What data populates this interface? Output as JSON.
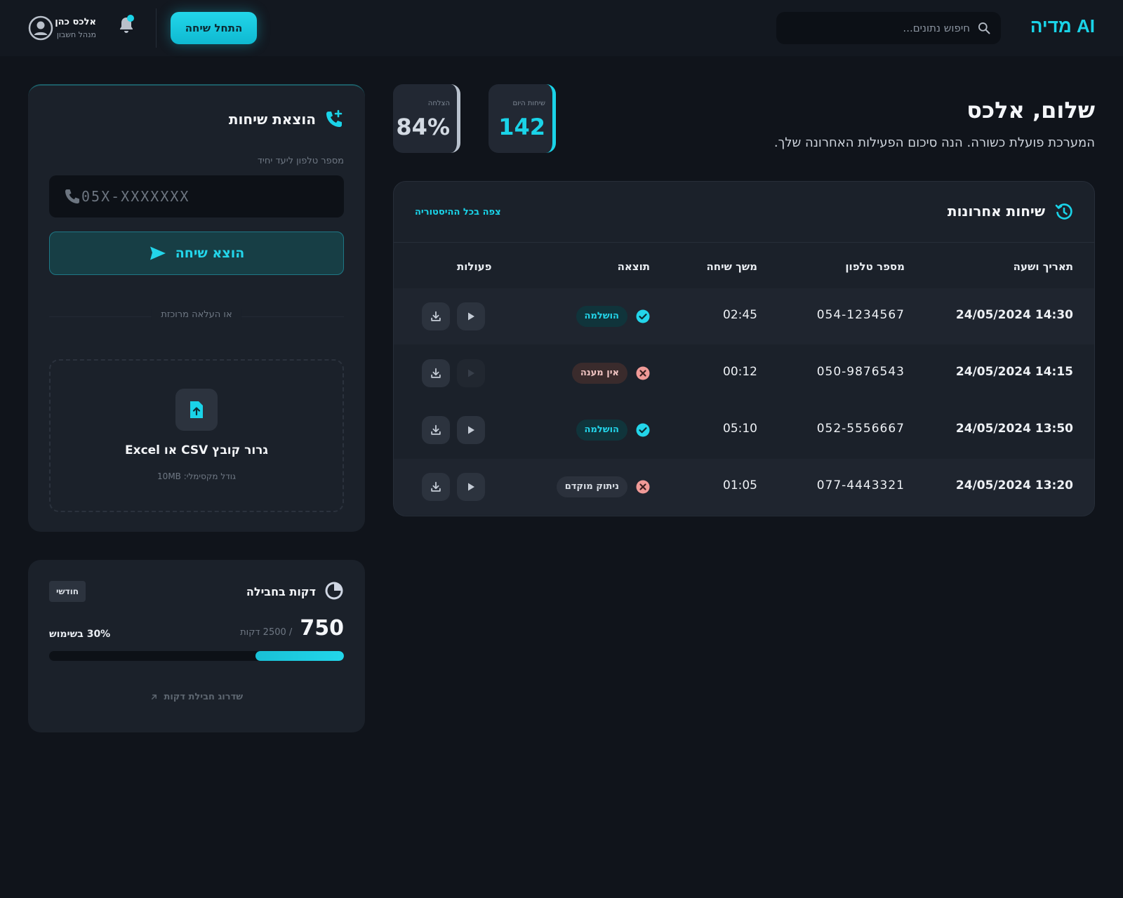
{
  "header": {
    "brand": "AI מדיה",
    "search_placeholder": "חיפוש נתונים...",
    "start_call_label": "התחל שיחה",
    "user_name": "אלכס כהן",
    "user_role": "מנהל חשבון"
  },
  "greeting": {
    "title": "שלום, אלכס",
    "subtitle": "המערכת פועלת כשורה. הנה סיכום הפעילות האחרונה שלך."
  },
  "stats": [
    {
      "label": "שיחות היום",
      "value": "142"
    },
    {
      "label": "הצלחה",
      "value": "84%"
    }
  ],
  "recent_calls": {
    "title": "שיחות אחרונות",
    "view_all": "צפה בכל ההיסטוריה",
    "columns": [
      "תאריך ושעה",
      "מספר טלפון",
      "משך שיחה",
      "תוצאה",
      "פעולות"
    ],
    "rows": [
      {
        "datetime": "14:30 24/05/2024",
        "phone": "054-1234567",
        "duration": "02:45",
        "result": "הושלמה",
        "status": "ok"
      },
      {
        "datetime": "14:15 24/05/2024",
        "phone": "050-9876543",
        "duration": "00:12",
        "result": "אין מענה",
        "status": "bad"
      },
      {
        "datetime": "13:50 24/05/2024",
        "phone": "052-5556667",
        "duration": "05:10",
        "result": "הושלמה",
        "status": "ok"
      },
      {
        "datetime": "13:20 24/05/2024",
        "phone": "077-4443321",
        "duration": "01:05",
        "result": "ניתוק מוקדם",
        "status": "neutral"
      }
    ]
  },
  "outbound": {
    "title": "הוצאת שיחות",
    "input_label": "מספר טלפון ליעד יחיד",
    "input_placeholder": "05X-XXXXXXX",
    "call_button": "הוצא שיחה",
    "or_upload": "או העלאה מרוכזת",
    "drop_text": "גרור קובץ CSV או Excel",
    "drop_subtext": "גודל מקסימלי: 10MB"
  },
  "package": {
    "title": "דקות בחבילה",
    "period_badge": "חודשי",
    "used": "750",
    "total_text": "/ 2500 דקות",
    "usage_text": "30% בשימוש",
    "usage_fraction": 0.3,
    "upgrade": "שדרוג חבילת דקות"
  },
  "colors": {
    "accent": "#1ad3e8",
    "background": "#10141b",
    "panel": "#1b212a",
    "success_badge": "#10343b",
    "error_icon": "#f09a97"
  },
  "icons": {
    "search": "search-icon",
    "bell": "bell-icon",
    "avatar": "user-circle-icon",
    "history": "history-icon",
    "phone_plus": "phone-plus-icon",
    "phone": "phone-icon",
    "send": "send-icon",
    "upload": "file-upload-icon",
    "pie": "pie-clock-icon",
    "download": "download-icon",
    "play": "play-icon",
    "check": "check-circle-icon",
    "x": "x-circle-icon",
    "arrow": "arrow-up-right-icon"
  }
}
